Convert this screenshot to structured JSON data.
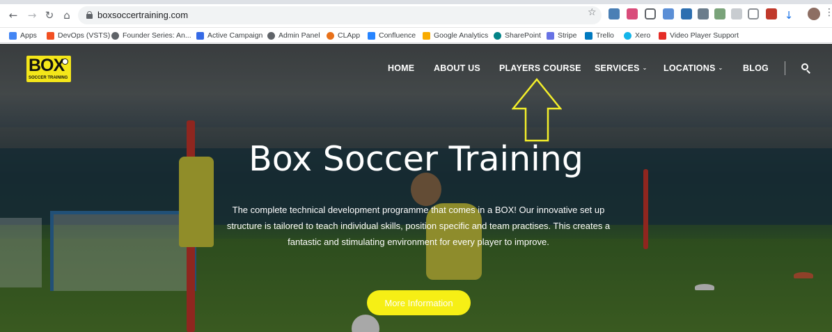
{
  "browser": {
    "url": "boxsoccertraining.com",
    "bookmarks": [
      {
        "label": "Apps",
        "color": "#4285f4"
      },
      {
        "label": "DevOps (VSTS)",
        "color": "#f25022"
      },
      {
        "label": "Founder Series: An...",
        "color": "#5f6368"
      },
      {
        "label": "Active Campaign",
        "color": "#356ae6"
      },
      {
        "label": "Admin Panel",
        "color": "#5f6368"
      },
      {
        "label": "CLApp",
        "color": "#e8711a"
      },
      {
        "label": "Confluence",
        "color": "#2684ff"
      },
      {
        "label": "Google Analytics",
        "color": "#f9ab00"
      },
      {
        "label": "SharePoint",
        "color": "#038387"
      },
      {
        "label": "Stripe",
        "color": "#6772e5"
      },
      {
        "label": "Trello",
        "color": "#0079bf"
      },
      {
        "label": "Xero",
        "color": "#13b5ea"
      },
      {
        "label": "Video Player Support",
        "color": "#e52d27"
      }
    ]
  },
  "site": {
    "logo": {
      "word": "BOX",
      "sub": "SOCCER TRAINING"
    },
    "nav": [
      {
        "label": "HOME"
      },
      {
        "label": "ABOUT US"
      },
      {
        "label": "PLAYERS COURSE"
      },
      {
        "label": "SERVICES"
      },
      {
        "label": "LOCATIONS"
      },
      {
        "label": "BLOG"
      }
    ],
    "hero": {
      "title": "Box Soccer Training",
      "text": "The complete technical development programme that comes in a BOX! Our innovative set up structure is tailored to teach individual skills, position specific and team practises. This creates a fantastic and stimulating environment for every player to improve.",
      "cta": "More Information"
    },
    "colors": {
      "accent": "#f6ef15",
      "annotation_arrow": "#f4ef2a"
    }
  }
}
